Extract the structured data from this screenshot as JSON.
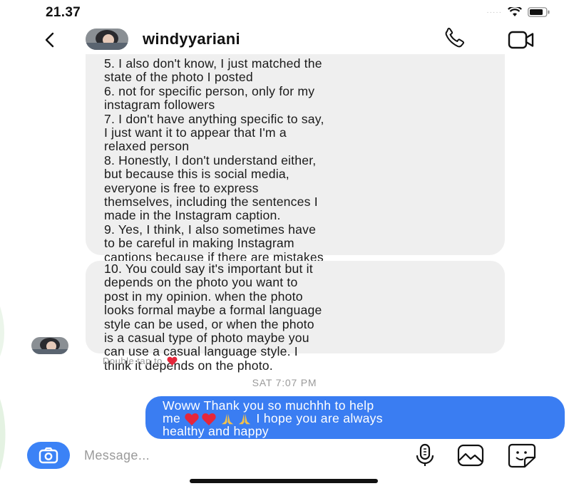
{
  "status_bar": {
    "time": "21.37"
  },
  "header": {
    "username": "windyyariani",
    "back_icon": "chevron-left-icon",
    "call_icon": "phone-icon",
    "video_icon": "video-camera-icon"
  },
  "thread": {
    "messages": [
      {
        "from": "windyyariani",
        "text": "5. I also don't know, I just matched the\nstate of the photo I posted\n6. not for specific person, only for my\ninstagram followers\n7. I don't have anything specific to say,\nI just want it to appear that I'm a\nrelaxed person\n8. Honestly, I don't understand either,\nbut because this is social media,\neveryone is free to express\nthemselves, including the sentences I\nmade in the Instagram caption.\n9. Yes, I think, I also sometimes have\nto be careful in making Instagram\ncaptions because if there are mistakes\nin grammar or other things it will be\nembarrassing."
      },
      {
        "from": "windyyariani",
        "text": "10. You could say it's important but it\ndepends on the photo you want to\npost in my opinion.  when the photo\nlooks formal maybe a formal language\nstyle can be used, or when the photo\nis a casual type of photo maybe you\ncan use a casual language style.  I\nthink it depends on the photo."
      }
    ],
    "double_tap_hint": "Double tap to",
    "double_tap_icon": "heart-icon",
    "date_separator": "SAT 7:07 PM",
    "outgoing": {
      "line1": "Woww Thank you so muchhh to help",
      "line2_prefix": "me ",
      "line2_suffix": " I hope you are always",
      "line3": "healthy and happy",
      "emojis": [
        "red-heart",
        "red-heart",
        "folded-hands",
        "folded-hands"
      ]
    }
  },
  "composer": {
    "placeholder": "Message...",
    "camera_icon": "camera-icon",
    "mic_icon": "microphone-icon",
    "gallery_icon": "gallery-icon",
    "sticker_icon": "sticker-icon"
  },
  "colors": {
    "accent": "#3b82f6",
    "outgoing_bubble": "#3a7df2",
    "incoming_bubble": "#efefef",
    "heart": "#e5263a"
  }
}
